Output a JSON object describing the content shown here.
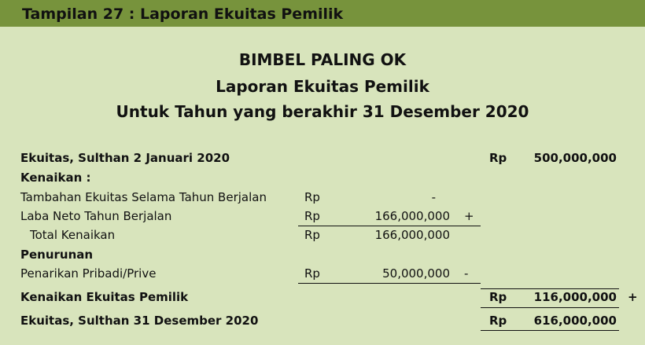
{
  "banner": {
    "title": "Tampilan 27 : Laporan Ekuitas Pemilik"
  },
  "heading": {
    "company": "BIMBEL PALING OK",
    "report": "Laporan Ekuitas Pemilik",
    "period": "Untuk Tahun yang berakhir 31 Desember 2020"
  },
  "rows": {
    "opening": {
      "label": "Ekuitas, Sulthan 2 Januari 2020",
      "currency": "Rp",
      "amount": "500,000,000"
    },
    "increase_header": {
      "label": "Kenaikan :"
    },
    "additional_equity": {
      "label": "Tambahan Ekuitas Selama Tahun Berjalan",
      "currency": "Rp",
      "amount": "-"
    },
    "net_income": {
      "label": "Laba Neto Tahun Berjalan",
      "currency": "Rp",
      "amount": "166,000,000",
      "sign": "+"
    },
    "total_increase": {
      "label": "Total Kenaikan",
      "currency": "Rp",
      "amount": "166,000,000"
    },
    "decrease_header": {
      "label": "Penurunan"
    },
    "withdrawals": {
      "label": "Penarikan Pribadi/Prive",
      "currency": "Rp",
      "amount": "50,000,000",
      "sign": "-"
    },
    "equity_increase": {
      "label": "Kenaikan Ekuitas Pemilik",
      "currency": "Rp",
      "amount": "116,000,000",
      "sign": "+"
    },
    "closing": {
      "label": "Ekuitas, Sulthan 31 Desember 2020",
      "currency": "Rp",
      "amount": "616,000,000"
    }
  }
}
